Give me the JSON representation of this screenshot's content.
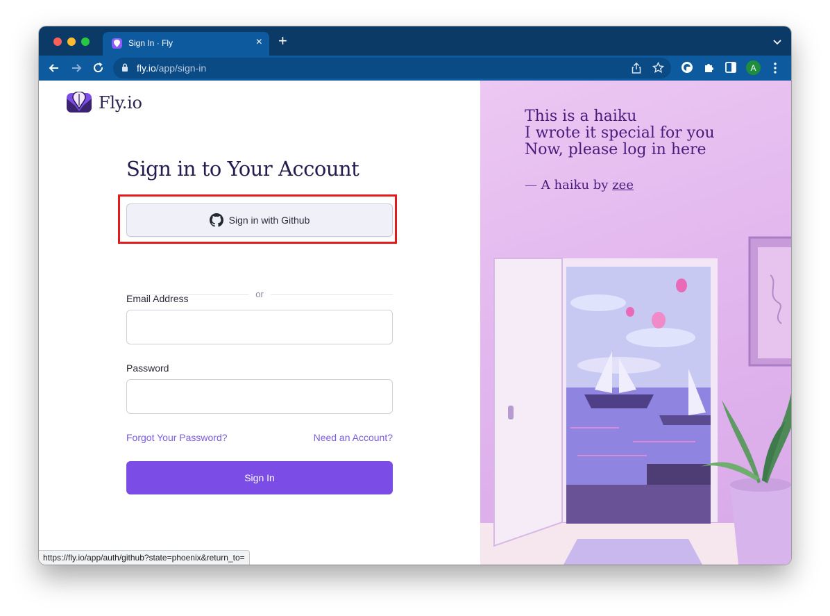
{
  "browser": {
    "tab_title": "Sign In · Fly",
    "url_host": "fly.io",
    "url_path": "/app/sign-in",
    "profile_initial": "A",
    "status_url": "https://fly.io/app/auth/github?state=phoenix&return_to="
  },
  "brand": {
    "name": "Fly.io"
  },
  "form": {
    "heading": "Sign in to Your Account",
    "github_button": "Sign in with Github",
    "divider": "or",
    "email_label": "Email Address",
    "email_value": "",
    "password_label": "Password",
    "password_value": "",
    "forgot_link": "Forgot Your Password?",
    "need_account_link": "Need an Account?",
    "submit": "Sign In"
  },
  "haiku": {
    "lines": [
      "This is a haiku",
      "I wrote it special for you",
      "Now, please log in here"
    ],
    "dash": "—",
    "attribution_prefix": "A haiku by",
    "author": "zee"
  },
  "colors": {
    "accent": "#7b4ce6",
    "link": "#7c5ce0",
    "heading": "#221c4f",
    "highlight": "#e31b1b",
    "browser_frame": "#0b3a66"
  }
}
